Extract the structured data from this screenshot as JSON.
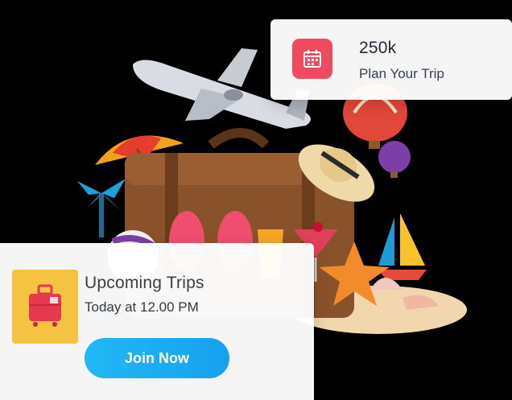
{
  "stats_card": {
    "value": "250k",
    "label": "Plan Your Trip",
    "icon": "calendar-icon",
    "accent_color": "#ef4b5f"
  },
  "trip_card": {
    "title": "Upcoming Trips",
    "time": "Today at 12.00 PM",
    "button_label": "Join Now",
    "icon": "suitcase-icon",
    "accent_color": "#f5c242",
    "button_color": "#1aa9f2"
  },
  "illustration": {
    "elements": [
      "airplane-icon",
      "umbrella-icon",
      "suitcase-icon",
      "hat-icon",
      "hot-air-balloon-icon",
      "flip-flops-icon",
      "starfish-icon",
      "seashell-icon",
      "cocktail-icon",
      "palm-tree-icon",
      "sailboat-icon",
      "beach-ball-icon"
    ]
  }
}
